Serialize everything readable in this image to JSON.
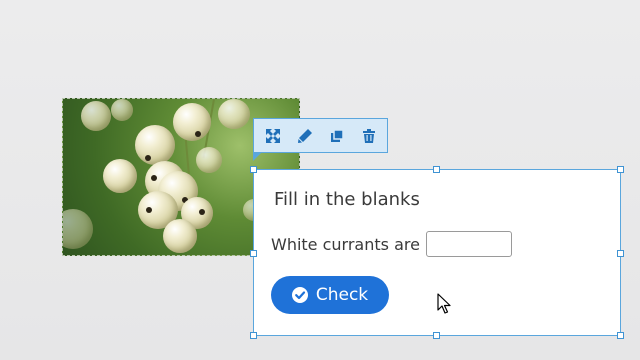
{
  "toolbar": {
    "icons": [
      "expand-icon",
      "pencil-icon",
      "duplicate-icon",
      "trash-icon"
    ]
  },
  "image": {
    "subject": "white currants"
  },
  "question": {
    "title": "Fill in the blanks",
    "sentence_prefix": "White currants are",
    "blank_value": "",
    "check_label": "Check"
  },
  "colors": {
    "accent": "#1f72d8",
    "selection_border": "#5aa6dd",
    "toolbar_bg": "#d6e9f8",
    "icon_color": "#1f6fb8"
  }
}
